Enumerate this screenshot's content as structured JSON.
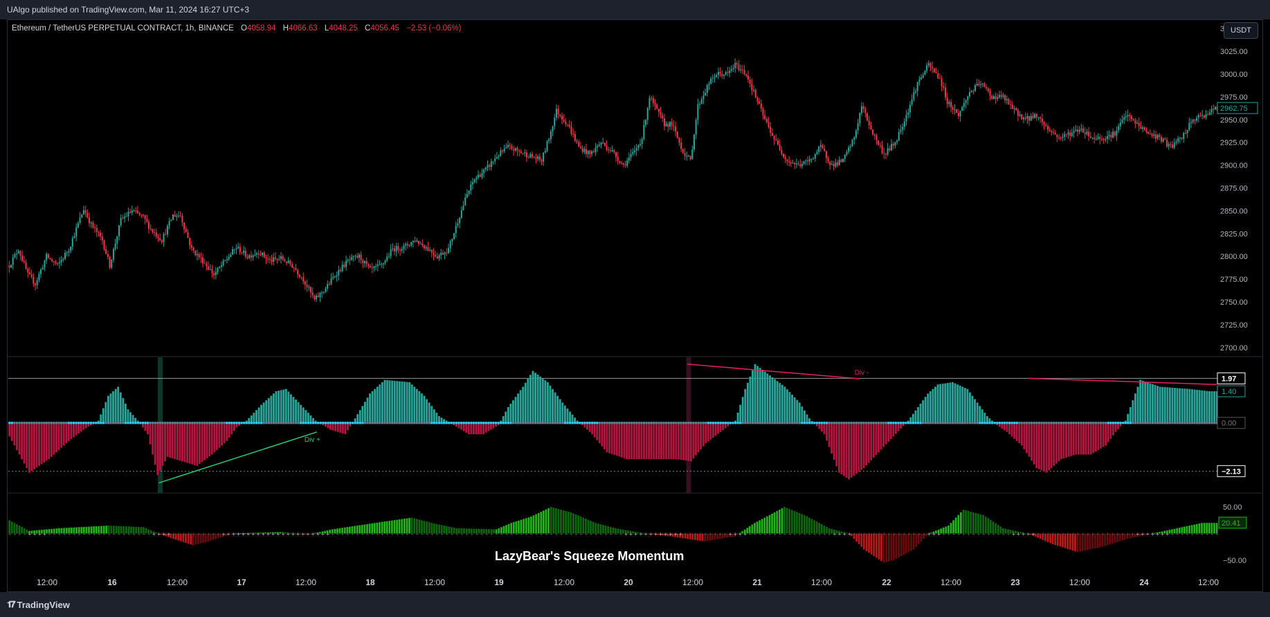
{
  "header": {
    "published": "UAlgo published on TradingView.com, Mar 11, 2024 16:27 UTC+3"
  },
  "legend": {
    "symbol": "Ethereum / TetherUS PERPETUAL CONTRACT, 1h, BINANCE",
    "o_label": "O",
    "o_value": "4058.94",
    "h_label": "H",
    "h_value": "4066.63",
    "l_label": "L",
    "l_value": "4048.25",
    "c_label": "C",
    "c_value": "4056.45",
    "change": "−2.53 (−0.06%)"
  },
  "currency_button": "USDT",
  "footer": {
    "brand": "TradingView"
  },
  "indicator_title": "LazyBear's Squeeze Momentum",
  "colors": {
    "up": "#26a69a",
    "down": "#f23645",
    "osc_up": "#26a69a",
    "osc_down": "#b2163f",
    "sqz_dot": "#2ec6f0",
    "mom_up": "#1fb915",
    "mom_down": "#c01818",
    "div_bull": "#2ecc71",
    "div_bear": "#e91e63"
  },
  "chart_data": [
    {
      "type": "candlestick",
      "title": "Ethereum / TetherUS PERPETUAL CONTRACT, 1h, BINANCE",
      "ylim": [
        2690,
        3060
      ],
      "y_ticks": [
        "3050.00",
        "3025.00",
        "3000.00",
        "2975.00",
        "2950.00",
        "2925.00",
        "2900.00",
        "2875.00",
        "2850.00",
        "2825.00",
        "2800.00",
        "2775.00",
        "2750.00",
        "2725.00",
        "2700.00"
      ],
      "last_price": "2962.75",
      "x_ticks": [
        "12:00",
        "16",
        "12:00",
        "17",
        "12:00",
        "18",
        "12:00",
        "19",
        "12:00",
        "20",
        "12:00",
        "21",
        "12:00",
        "22",
        "12:00",
        "23",
        "12:00",
        "24",
        "12:00"
      ],
      "close_path": [
        [
          0,
          2790
        ],
        [
          5,
          2808
        ],
        [
          10,
          2780
        ],
        [
          14,
          2770
        ],
        [
          20,
          2800
        ],
        [
          26,
          2790
        ],
        [
          32,
          2808
        ],
        [
          40,
          2852
        ],
        [
          44,
          2835
        ],
        [
          50,
          2818
        ],
        [
          54,
          2790
        ],
        [
          60,
          2840
        ],
        [
          66,
          2850
        ],
        [
          72,
          2843
        ],
        [
          76,
          2830
        ],
        [
          82,
          2818
        ],
        [
          88,
          2845
        ],
        [
          92,
          2845
        ],
        [
          98,
          2808
        ],
        [
          104,
          2795
        ],
        [
          110,
          2780
        ],
        [
          116,
          2795
        ],
        [
          122,
          2810
        ],
        [
          128,
          2800
        ],
        [
          134,
          2805
        ],
        [
          140,
          2795
        ],
        [
          146,
          2798
        ],
        [
          152,
          2790
        ],
        [
          158,
          2775
        ],
        [
          164,
          2752
        ],
        [
          170,
          2765
        ],
        [
          176,
          2782
        ],
        [
          182,
          2795
        ],
        [
          188,
          2800
        ],
        [
          194,
          2785
        ],
        [
          200,
          2790
        ],
        [
          206,
          2808
        ],
        [
          212,
          2810
        ],
        [
          218,
          2818
        ],
        [
          224,
          2810
        ],
        [
          230,
          2800
        ],
        [
          236,
          2808
        ],
        [
          242,
          2845
        ],
        [
          246,
          2868
        ],
        [
          250,
          2885
        ],
        [
          256,
          2895
        ],
        [
          262,
          2910
        ],
        [
          268,
          2920
        ],
        [
          274,
          2915
        ],
        [
          280,
          2910
        ],
        [
          286,
          2905
        ],
        [
          290,
          2930
        ],
        [
          294,
          2960
        ],
        [
          300,
          2945
        ],
        [
          306,
          2920
        ],
        [
          312,
          2912
        ],
        [
          318,
          2925
        ],
        [
          324,
          2915
        ],
        [
          330,
          2900
        ],
        [
          336,
          2915
        ],
        [
          340,
          2930
        ],
        [
          344,
          2975
        ],
        [
          348,
          2960
        ],
        [
          352,
          2945
        ],
        [
          356,
          2945
        ],
        [
          362,
          2915
        ],
        [
          366,
          2905
        ],
        [
          370,
          2965
        ],
        [
          376,
          2990
        ],
        [
          380,
          3000
        ],
        [
          386,
          3000
        ],
        [
          390,
          3010
        ],
        [
          396,
          3000
        ],
        [
          400,
          2980
        ],
        [
          406,
          2950
        ],
        [
          412,
          2925
        ],
        [
          418,
          2905
        ],
        [
          424,
          2900
        ],
        [
          430,
          2905
        ],
        [
          436,
          2920
        ],
        [
          442,
          2900
        ],
        [
          448,
          2905
        ],
        [
          454,
          2930
        ],
        [
          458,
          2965
        ],
        [
          464,
          2935
        ],
        [
          470,
          2912
        ],
        [
          476,
          2925
        ],
        [
          482,
          2955
        ],
        [
          488,
          2990
        ],
        [
          494,
          3010
        ],
        [
          500,
          2995
        ],
        [
          504,
          2970
        ],
        [
          510,
          2955
        ],
        [
          516,
          2980
        ],
        [
          522,
          2990
        ],
        [
          528,
          2975
        ],
        [
          534,
          2975
        ],
        [
          540,
          2960
        ],
        [
          546,
          2950
        ],
        [
          552,
          2955
        ],
        [
          558,
          2940
        ],
        [
          564,
          2930
        ],
        [
          570,
          2935
        ],
        [
          576,
          2940
        ],
        [
          582,
          2930
        ],
        [
          588,
          2930
        ],
        [
          594,
          2935
        ],
        [
          600,
          2955
        ],
        [
          606,
          2945
        ],
        [
          612,
          2935
        ],
        [
          618,
          2930
        ],
        [
          624,
          2920
        ],
        [
          630,
          2930
        ],
        [
          636,
          2950
        ],
        [
          642,
          2955
        ],
        [
          648,
          2962
        ]
      ],
      "bars": 650
    },
    {
      "type": "bar",
      "title": "",
      "ylim": [
        -3.1,
        2.9
      ],
      "levels": {
        "upper": "1.97",
        "upper_value": 1.97,
        "current": "1.40",
        "current_value": 1.4,
        "zero": "0.00",
        "lower": "−2.13",
        "lower_value": -2.13
      },
      "series_path": [
        [
          0,
          -0.6
        ],
        [
          8,
          -2.2
        ],
        [
          16,
          -1.6
        ],
        [
          24,
          -0.8
        ],
        [
          30,
          -0.3
        ],
        [
          36,
          0.1
        ],
        [
          40,
          1.2
        ],
        [
          44,
          1.6
        ],
        [
          48,
          0.6
        ],
        [
          52,
          0.1
        ],
        [
          56,
          -0.5
        ],
        [
          60,
          -2.3
        ],
        [
          64,
          -1.5
        ],
        [
          70,
          -1.7
        ],
        [
          76,
          -1.9
        ],
        [
          82,
          -1.4
        ],
        [
          88,
          -0.8
        ],
        [
          92,
          -0.2
        ],
        [
          96,
          0.1
        ],
        [
          102,
          0.8
        ],
        [
          108,
          1.4
        ],
        [
          112,
          1.5
        ],
        [
          118,
          0.8
        ],
        [
          124,
          0.1
        ],
        [
          130,
          -0.3
        ],
        [
          136,
          -0.5
        ],
        [
          140,
          0.2
        ],
        [
          146,
          1.3
        ],
        [
          152,
          1.9
        ],
        [
          162,
          1.8
        ],
        [
          168,
          1.2
        ],
        [
          174,
          0.3
        ],
        [
          180,
          -0.1
        ],
        [
          186,
          -0.5
        ],
        [
          192,
          -0.5
        ],
        [
          198,
          -0.1
        ],
        [
          202,
          0.7
        ],
        [
          208,
          1.6
        ],
        [
          212,
          2.3
        ],
        [
          218,
          1.8
        ],
        [
          224,
          0.9
        ],
        [
          230,
          0.1
        ],
        [
          236,
          -0.5
        ],
        [
          242,
          -1.3
        ],
        [
          250,
          -1.6
        ],
        [
          262,
          -1.6
        ],
        [
          270,
          -1.6
        ],
        [
          276,
          -1.7
        ],
        [
          282,
          -0.9
        ],
        [
          288,
          -0.4
        ],
        [
          294,
          0.1
        ],
        [
          298,
          1.5
        ],
        [
          302,
          2.6
        ],
        [
          308,
          2.1
        ],
        [
          314,
          1.6
        ],
        [
          320,
          0.9
        ],
        [
          324,
          0.2
        ],
        [
          330,
          -0.5
        ],
        [
          336,
          -2.2
        ],
        [
          340,
          -2.5
        ],
        [
          346,
          -2.0
        ],
        [
          352,
          -1.3
        ],
        [
          358,
          -0.6
        ],
        [
          364,
          0.1
        ],
        [
          368,
          0.7
        ],
        [
          372,
          1.3
        ],
        [
          376,
          1.7
        ],
        [
          382,
          1.8
        ],
        [
          388,
          1.5
        ],
        [
          392,
          0.9
        ],
        [
          396,
          0.3
        ],
        [
          400,
          -0.1
        ],
        [
          404,
          -0.4
        ],
        [
          410,
          -1.0
        ],
        [
          416,
          -2.0
        ],
        [
          420,
          -2.2
        ],
        [
          426,
          -1.6
        ],
        [
          432,
          -1.4
        ],
        [
          438,
          -1.4
        ],
        [
          444,
          -1.0
        ],
        [
          448,
          -0.4
        ],
        [
          452,
          0.1
        ],
        [
          458,
          1.9
        ],
        [
          466,
          1.6
        ],
        [
          478,
          1.5
        ],
        [
          486,
          1.4
        ],
        [
          489,
          1.4
        ]
      ],
      "bars": 490,
      "divergences": [
        {
          "label": "Div +",
          "kind": "bullish"
        },
        {
          "label": "Div -",
          "kind": "bearish"
        }
      ]
    },
    {
      "type": "bar",
      "title": "LazyBear's Squeeze Momentum",
      "ylim": [
        -75,
        75
      ],
      "levels": {
        "upper": "50.00",
        "current": "20.41",
        "lower": "−50.00"
      },
      "series_path": [
        [
          0,
          25
        ],
        [
          8,
          5
        ],
        [
          20,
          10
        ],
        [
          40,
          15
        ],
        [
          54,
          12
        ],
        [
          60,
          0
        ],
        [
          66,
          -10
        ],
        [
          74,
          -22
        ],
        [
          80,
          -15
        ],
        [
          90,
          0
        ],
        [
          110,
          3
        ],
        [
          120,
          -2
        ],
        [
          130,
          8
        ],
        [
          150,
          22
        ],
        [
          162,
          30
        ],
        [
          170,
          20
        ],
        [
          180,
          10
        ],
        [
          196,
          8
        ],
        [
          202,
          20
        ],
        [
          210,
          32
        ],
        [
          218,
          50
        ],
        [
          226,
          40
        ],
        [
          236,
          20
        ],
        [
          244,
          10
        ],
        [
          256,
          0
        ],
        [
          266,
          -5
        ],
        [
          280,
          -15
        ],
        [
          292,
          -5
        ],
        [
          300,
          20
        ],
        [
          312,
          50
        ],
        [
          320,
          35
        ],
        [
          330,
          10
        ],
        [
          338,
          0
        ],
        [
          344,
          -30
        ],
        [
          352,
          -55
        ],
        [
          356,
          -50
        ],
        [
          364,
          -30
        ],
        [
          370,
          0
        ],
        [
          378,
          15
        ],
        [
          384,
          45
        ],
        [
          392,
          35
        ],
        [
          400,
          10
        ],
        [
          410,
          0
        ],
        [
          420,
          -20
        ],
        [
          430,
          -35
        ],
        [
          440,
          -25
        ],
        [
          450,
          -10
        ],
        [
          460,
          0
        ],
        [
          470,
          10
        ],
        [
          480,
          20
        ],
        [
          486,
          20
        ]
      ],
      "bars": 487
    }
  ]
}
